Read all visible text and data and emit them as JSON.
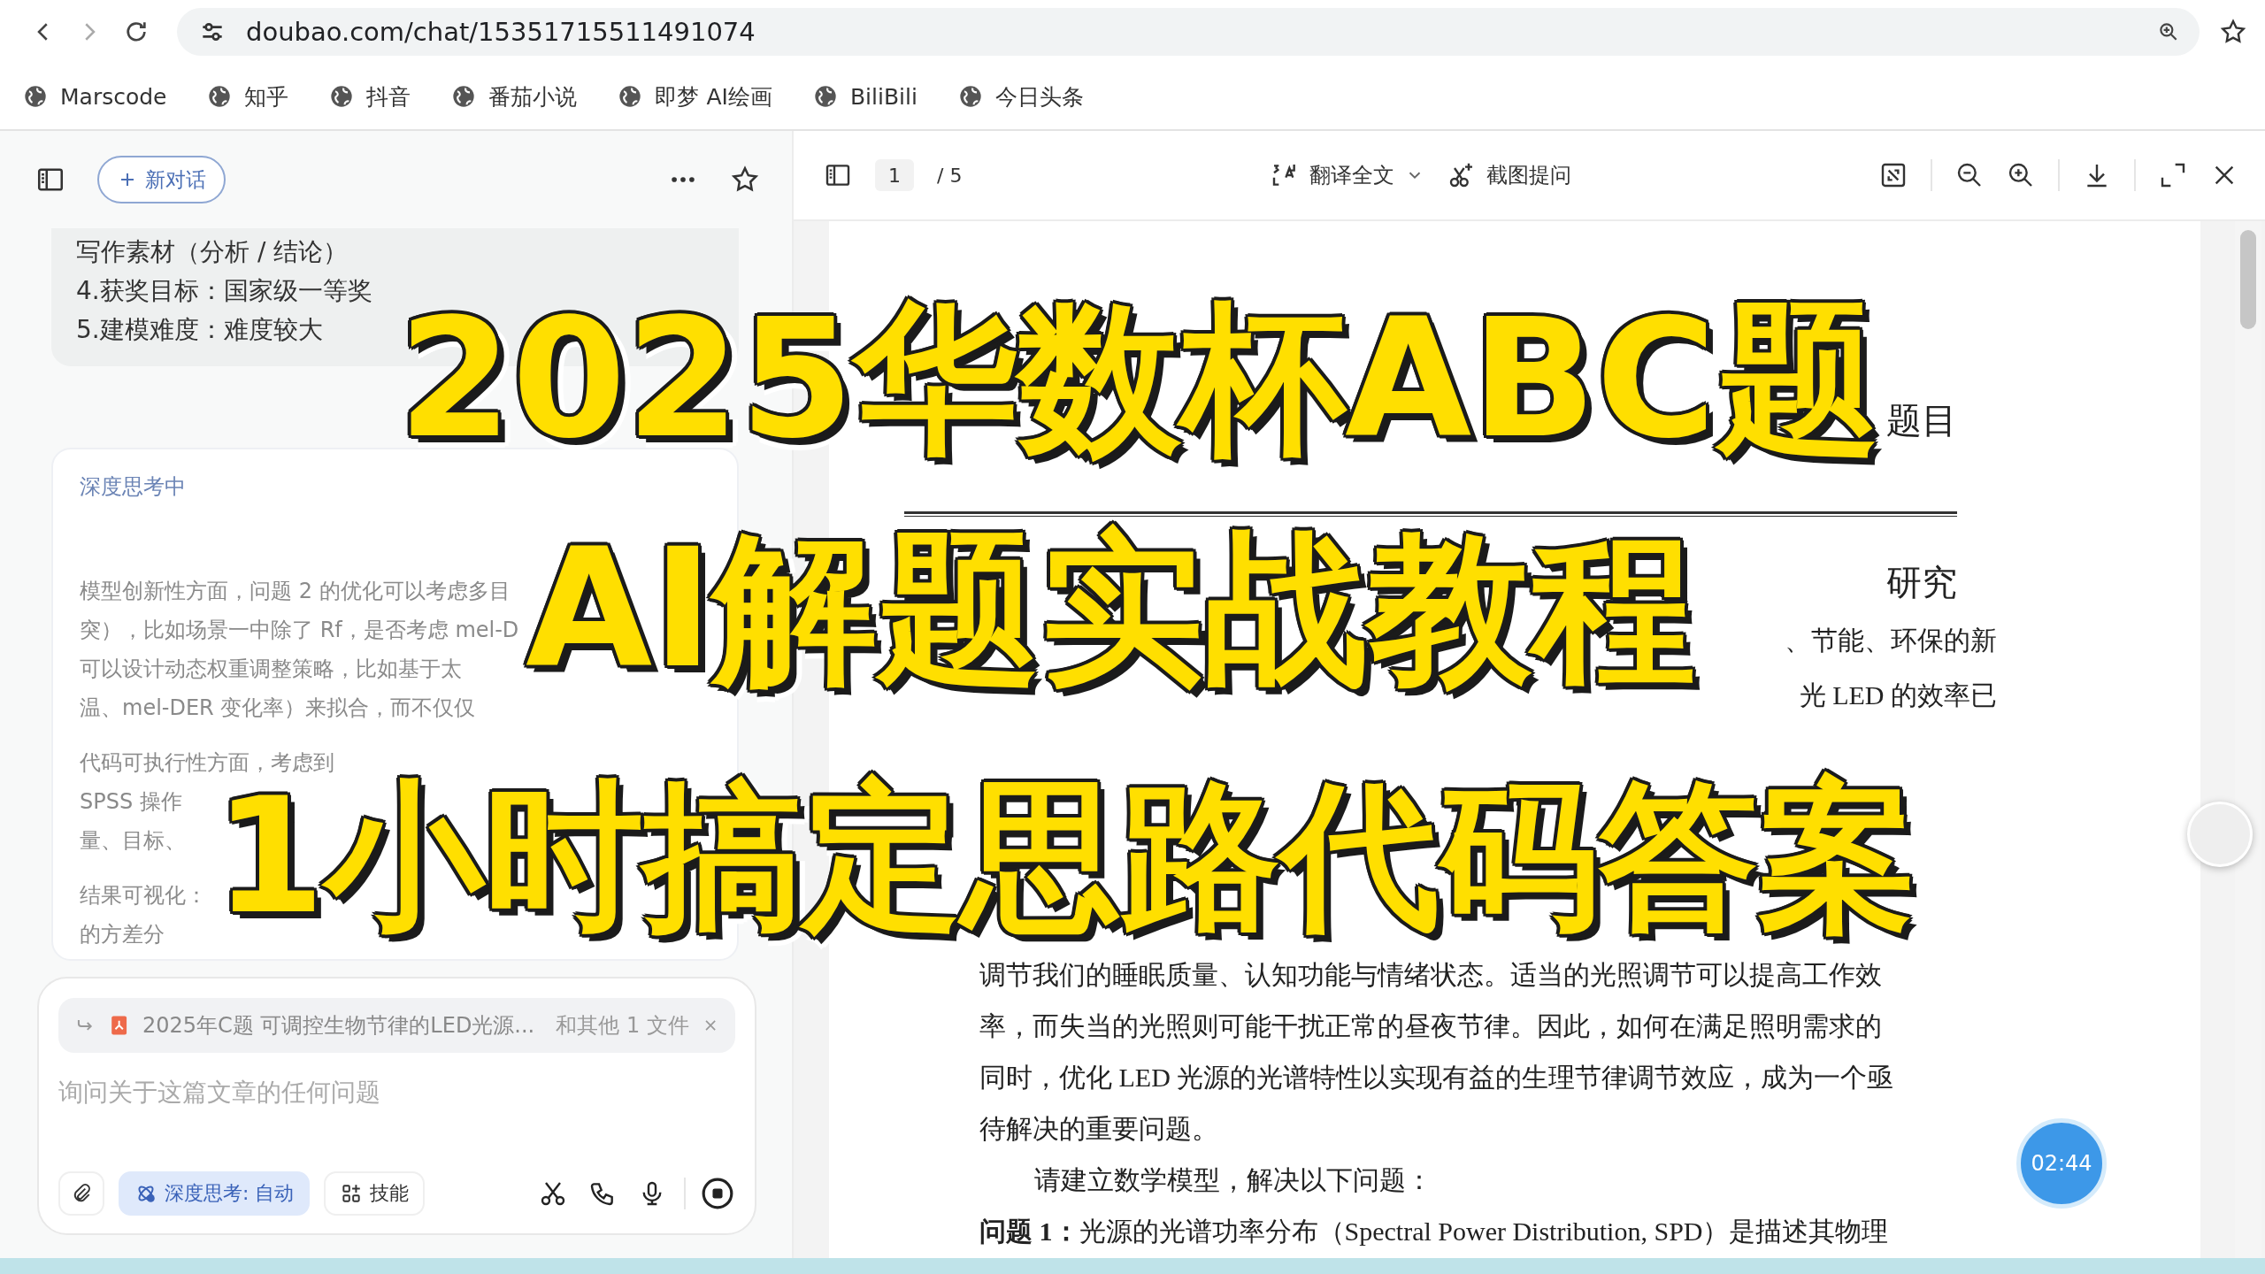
{
  "browser": {
    "url": "doubao.com/chat/15351715511491074",
    "bookmarks": [
      "Marscode",
      "知乎",
      "抖音",
      "番茄小说",
      "即梦 AI绘画",
      "BiliBili",
      "今日头条"
    ]
  },
  "chat": {
    "new_chat": "新对话",
    "card_lines": [
      "写作素材（分析 / 结论）",
      "4.获奖目标：国家级一等奖",
      "5.建模难度：难度较大"
    ],
    "thinking": {
      "title": "深度思考中",
      "paragraphs": [
        [
          "模型创新性方面，问题 2 的优化可以考虑多目",
          "突），比如场景一中除了 Rf，是否考虑 mel-D",
          "可以设计动态权重调整策略，比如基于太",
          "温、mel-DER 变化率）来拟合，而不仅仅"
        ],
        [
          "代码可执行性方面，考虑到",
          "SPSS 操作",
          "量、目标、"
        ],
        [
          "结果可视化：",
          "的方差分"
        ]
      ]
    },
    "input": {
      "attachment": {
        "name": "2025年C题 可调控生物节律的LED光源...",
        "more": "和其他 1 文件"
      },
      "placeholder": "询问关于这篇文章的任何问题",
      "tools": [
        {
          "kind": "deep-think",
          "label": "深度思考: 自动",
          "selected": true
        },
        {
          "kind": "skills",
          "label": "技能",
          "selected": false
        }
      ]
    }
  },
  "pdf": {
    "page": "1",
    "total": "/ 5",
    "translate": "翻译全文",
    "screenshot_ask": "截图提问",
    "top_lines": [
      {
        "kind": "heading",
        "text": "题目"
      },
      {
        "kind": "rule"
      },
      {
        "kind": "heading",
        "text": "研究"
      },
      {
        "kind": "tail",
        "text": "、节能、环保的新"
      },
      {
        "kind": "tail",
        "text": "光 LED 的效率已"
      }
    ],
    "body_lines": [
      {
        "kind": "body",
        "text": "调节我们的睡眠质量、认知功能与情绪状态。适当的光照调节可以提高工作效"
      },
      {
        "kind": "body",
        "text": "率，而失当的光照则可能干扰正常的昼夜节律。因此，如何在满足照明需求的"
      },
      {
        "kind": "body",
        "text": "同时，优化 LED 光源的光谱特性以实现有益的生理节律调节效应，成为一个亟"
      },
      {
        "kind": "body",
        "text": "待解决的重要问题。"
      },
      {
        "kind": "indent",
        "text": "请建立数学模型，解决以下问题："
      },
      {
        "kind": "body",
        "text": "**问题 1：**光源的光谱功率分布（Spectral Power Distribution, SPD）是描述其物理"
      }
    ],
    "timer": "02:44"
  },
  "overlay": {
    "lines": [
      "2025华数杯ABC题",
      "AI解题实战教程",
      "1小时搞定思路代码答案"
    ]
  }
}
